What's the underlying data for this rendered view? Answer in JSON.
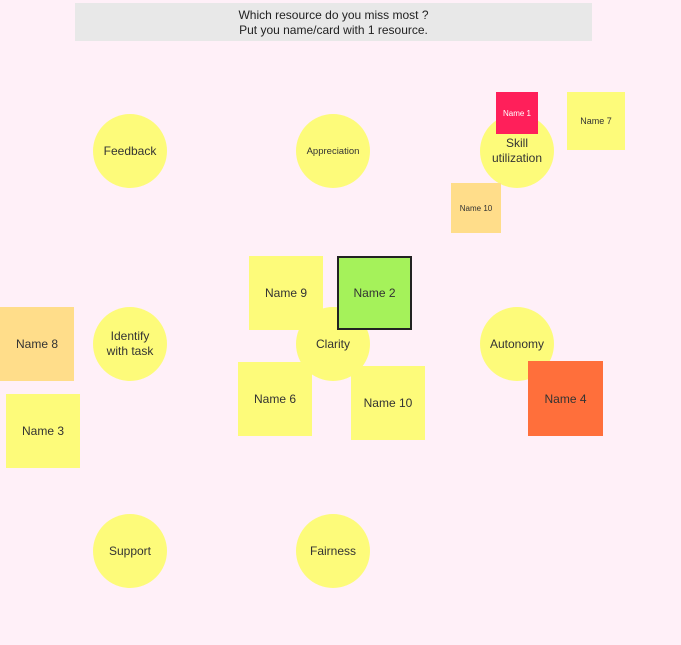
{
  "header": {
    "line1": "Which resource do you miss most ?",
    "line2": "Put you name/card with 1 resource."
  },
  "resources": {
    "feedback": "Feedback",
    "appreciation": "Appreciation",
    "skill_line1": "Skill",
    "skill_line2": "utilization",
    "identify_line1": "Identify",
    "identify_line2": "with task",
    "clarity": "Clarity",
    "autonomy": "Autonomy",
    "support": "Support",
    "fairness": "Fairness"
  },
  "notes": {
    "name1": "Name 1",
    "name7": "Name 7",
    "name10_small": "Name 10",
    "name9": "Name 9",
    "name2": "Name 2",
    "name8": "Name 8",
    "name3": "Name 3",
    "name6": "Name 6",
    "name10": "Name 10",
    "name4": "Name 4"
  },
  "colors": {
    "background": "#fff0f8",
    "resource_circle": "#fdfb7a",
    "note_yellow": "#fdfb7a",
    "note_light_orange": "#ffdd8a",
    "note_green": "#a5f25a",
    "note_orange": "#ff6f3b",
    "note_pink": "#ff1f5a"
  }
}
